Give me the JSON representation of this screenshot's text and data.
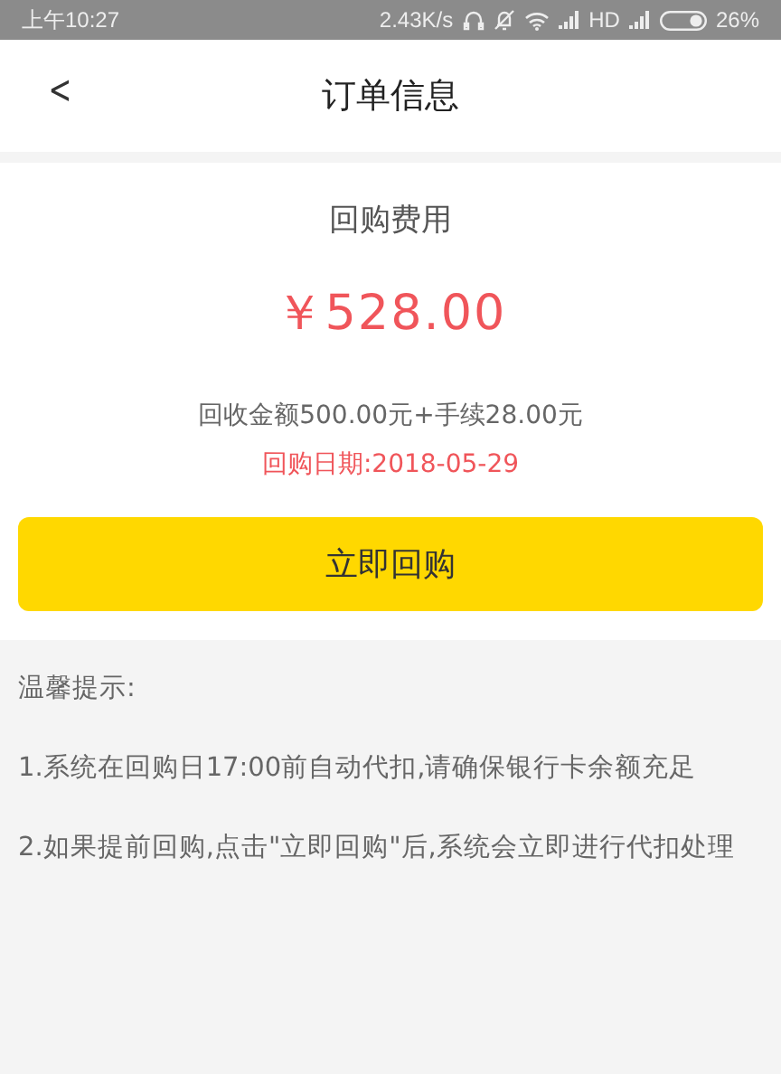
{
  "status_bar": {
    "time": "上午10:27",
    "speed": "2.43K/s",
    "network": "HD",
    "battery": "26%"
  },
  "header": {
    "back": "<",
    "title": "订单信息"
  },
  "summary": {
    "label": "回购费用",
    "amount": "￥528.00",
    "breakdown": "回收金额500.00元+手续28.00元",
    "date": "回购日期:2018-05-29"
  },
  "buttons": [
    "立即回购"
  ],
  "tips": {
    "title": "温馨提示:",
    "items": [
      "1.系统在回购日17:00前自动代扣,请确保银行卡余额充足",
      "2.如果提前回购,点击\"立即回购\"后,系统会立即进行代扣处理"
    ]
  }
}
